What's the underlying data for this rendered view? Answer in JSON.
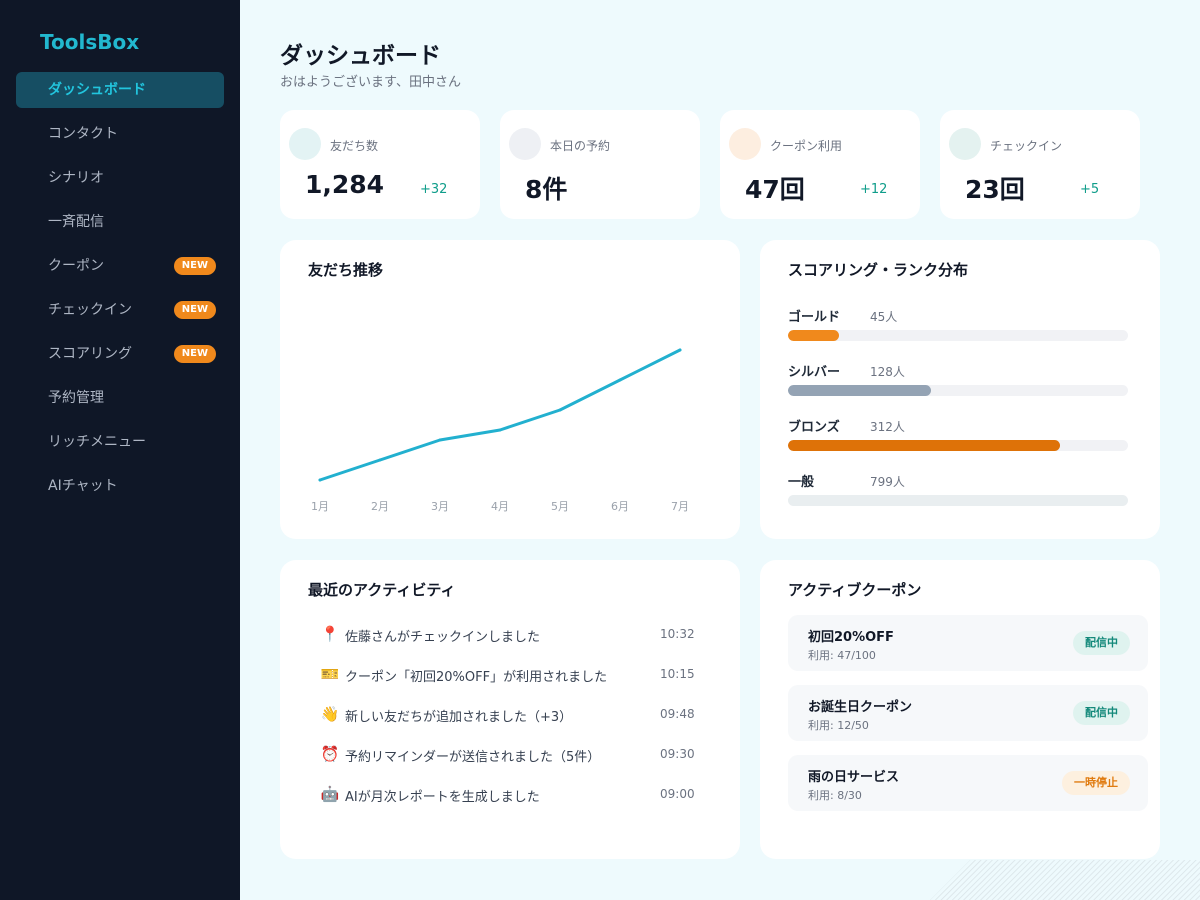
{
  "app": {
    "logo": "ToolsBox"
  },
  "sidebar": {
    "items": [
      {
        "label": "ダッシュボード",
        "active": true,
        "badge": ""
      },
      {
        "label": "コンタクト",
        "badge": ""
      },
      {
        "label": "シナリオ",
        "badge": ""
      },
      {
        "label": "一斉配信",
        "badge": ""
      },
      {
        "label": "クーポン",
        "badge": "NEW"
      },
      {
        "label": "チェックイン",
        "badge": "NEW"
      },
      {
        "label": "スコアリング",
        "badge": "NEW"
      },
      {
        "label": "予約管理",
        "badge": ""
      },
      {
        "label": "リッチメニュー",
        "badge": ""
      },
      {
        "label": "AIチャット",
        "badge": ""
      }
    ]
  },
  "header": {
    "title": "ダッシュボード",
    "greeting": "おはようございます、田中さん"
  },
  "stats": [
    {
      "label": "友だち数",
      "value": "1,284",
      "delta": "+32",
      "icon": "users-icon",
      "icon_color": "#e3f3f4"
    },
    {
      "label": "本日の予約",
      "value": "8件",
      "delta": "",
      "icon": "calendar-icon",
      "icon_color": "#eef0f4"
    },
    {
      "label": "クーポン利用",
      "value": "47回",
      "delta": "+12",
      "icon": "ticket-icon",
      "icon_color": "#fdeee0"
    },
    {
      "label": "チェックイン",
      "value": "23回",
      "delta": "+5",
      "icon": "checkin-icon",
      "icon_color": "#e4f2f0"
    }
  ],
  "friends_chart": {
    "title": "友だち推移",
    "chart_data": {
      "type": "line",
      "categories": [
        "1月",
        "2月",
        "3月",
        "4月",
        "5月",
        "6月",
        "7月"
      ],
      "values": [
        0,
        20,
        40,
        50,
        70,
        100,
        130
      ],
      "ylim": [
        0,
        130
      ],
      "grid": false,
      "color": "#22b0cf"
    }
  },
  "ranks": {
    "title": "スコアリング・ランク分布",
    "chart_data": {
      "type": "bar",
      "categories": [
        "ゴールド",
        "シルバー",
        "ブロンズ",
        "一般"
      ],
      "values": [
        45,
        128,
        312,
        799
      ],
      "labels": [
        "45人",
        "128人",
        "312人",
        "799人"
      ],
      "colors": [
        "#f0891c",
        "#94a3b4",
        "#de7208",
        "#e9eef0"
      ],
      "fill_fraction": [
        0.15,
        0.42,
        0.8,
        1.0
      ]
    }
  },
  "activity": {
    "title": "最近のアクティビティ",
    "items": [
      {
        "icon": "pin-icon",
        "glyph": "📍",
        "text": "佐藤さんがチェックインしました",
        "time": "10:32"
      },
      {
        "icon": "ticket-icon",
        "glyph": "🎫",
        "text": "クーポン「初回20%OFF」が利用されました",
        "time": "10:15"
      },
      {
        "icon": "wave-icon",
        "glyph": "👋",
        "text": "新しい友だちが追加されました（+3）",
        "time": "09:48"
      },
      {
        "icon": "alarm-icon",
        "glyph": "⏰",
        "text": "予約リマインダーが送信されました（5件）",
        "time": "09:30"
      },
      {
        "icon": "robot-icon",
        "glyph": "🤖",
        "text": "AIが月次レポートを生成しました",
        "time": "09:00"
      }
    ]
  },
  "coupons": {
    "title": "アクティブクーポン",
    "items": [
      {
        "name": "初回20%OFF",
        "usage": "利用: 47/100",
        "status": "配信中",
        "state": "on"
      },
      {
        "name": "お誕生日クーポン",
        "usage": "利用: 12/50",
        "status": "配信中",
        "state": "on"
      },
      {
        "name": "雨の日サービス",
        "usage": "利用: 8/30",
        "status": "一時停止",
        "state": "off"
      }
    ]
  }
}
